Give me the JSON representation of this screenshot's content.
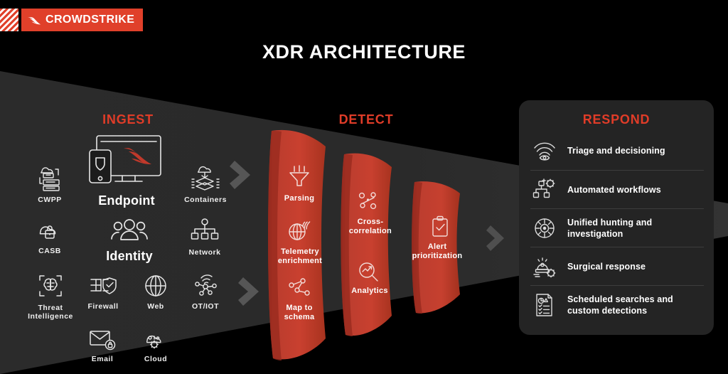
{
  "brand": {
    "name": "CROWDSTRIKE",
    "logo_icon": "crowdstrike-falcon-icon",
    "stripes_icon": "diagonal-stripes-block",
    "accent_red": "#e0402a",
    "panel_bg": "#242424",
    "funnel_red": "#c0392b"
  },
  "header": {
    "title": "XDR ARCHITECTURE"
  },
  "sections": {
    "ingest": {
      "label": "INGEST"
    },
    "detect": {
      "label": "DETECT"
    },
    "respond": {
      "label": "RESPOND"
    }
  },
  "ingest": {
    "items": [
      {
        "label": "CWPP",
        "icon": "cloud-server-icon"
      },
      {
        "label": "Endpoint",
        "icon": "monitor-phone-falcon-icon"
      },
      {
        "label": "Containers",
        "icon": "cloud-containers-icon"
      },
      {
        "label": "CASB",
        "icon": "cloud-lock-icon"
      },
      {
        "label": "Identity",
        "icon": "users-group-icon"
      },
      {
        "label": "Network",
        "icon": "network-hierarchy-icon"
      },
      {
        "label": "Threat Intelligence",
        "icon": "brain-scan-icon"
      },
      {
        "label": "Firewall",
        "icon": "firewall-shield-icon"
      },
      {
        "label": "Web",
        "icon": "globe-icon"
      },
      {
        "label": "OT/IOT",
        "icon": "iot-nodes-wifi-icon"
      },
      {
        "label": "Email",
        "icon": "envelope-lock-icon"
      },
      {
        "label": "Cloud",
        "icon": "cloud-gear-icon"
      }
    ]
  },
  "detect": {
    "stages": [
      {
        "steps": [
          {
            "label": "Parsing",
            "icon": "funnel-icon"
          },
          {
            "label": "Telemetry enrichment",
            "icon": "globe-signal-icon"
          },
          {
            "label": "Map to schema",
            "icon": "nodes-map-icon"
          }
        ]
      },
      {
        "steps": [
          {
            "label": "Cross-correlation",
            "icon": "percent-circles-icon"
          },
          {
            "label": "Analytics",
            "icon": "magnifier-chart-icon"
          }
        ]
      },
      {
        "steps": [
          {
            "label": "Alert prioritization",
            "icon": "clipboard-check-icon"
          }
        ]
      }
    ]
  },
  "respond": {
    "items": [
      {
        "label": "Triage and decisioning",
        "icon": "eye-signal-icon"
      },
      {
        "label": "Automated workflows",
        "icon": "workflow-gear-icon"
      },
      {
        "label": "Unified hunting and investigation",
        "icon": "crosshair-target-icon"
      },
      {
        "label": "Surgical response",
        "icon": "siren-gear-icon"
      },
      {
        "label": "Scheduled searches and custom detections",
        "icon": "scheduled-report-icon"
      }
    ]
  },
  "flow_arrows": [
    {
      "name": "ingest-to-detect-arrow-top",
      "icon": "chevron-right-icon"
    },
    {
      "name": "ingest-to-detect-arrow-bottom",
      "icon": "chevron-right-icon"
    },
    {
      "name": "detect-to-respond-arrow",
      "icon": "chevron-right-icon"
    }
  ]
}
